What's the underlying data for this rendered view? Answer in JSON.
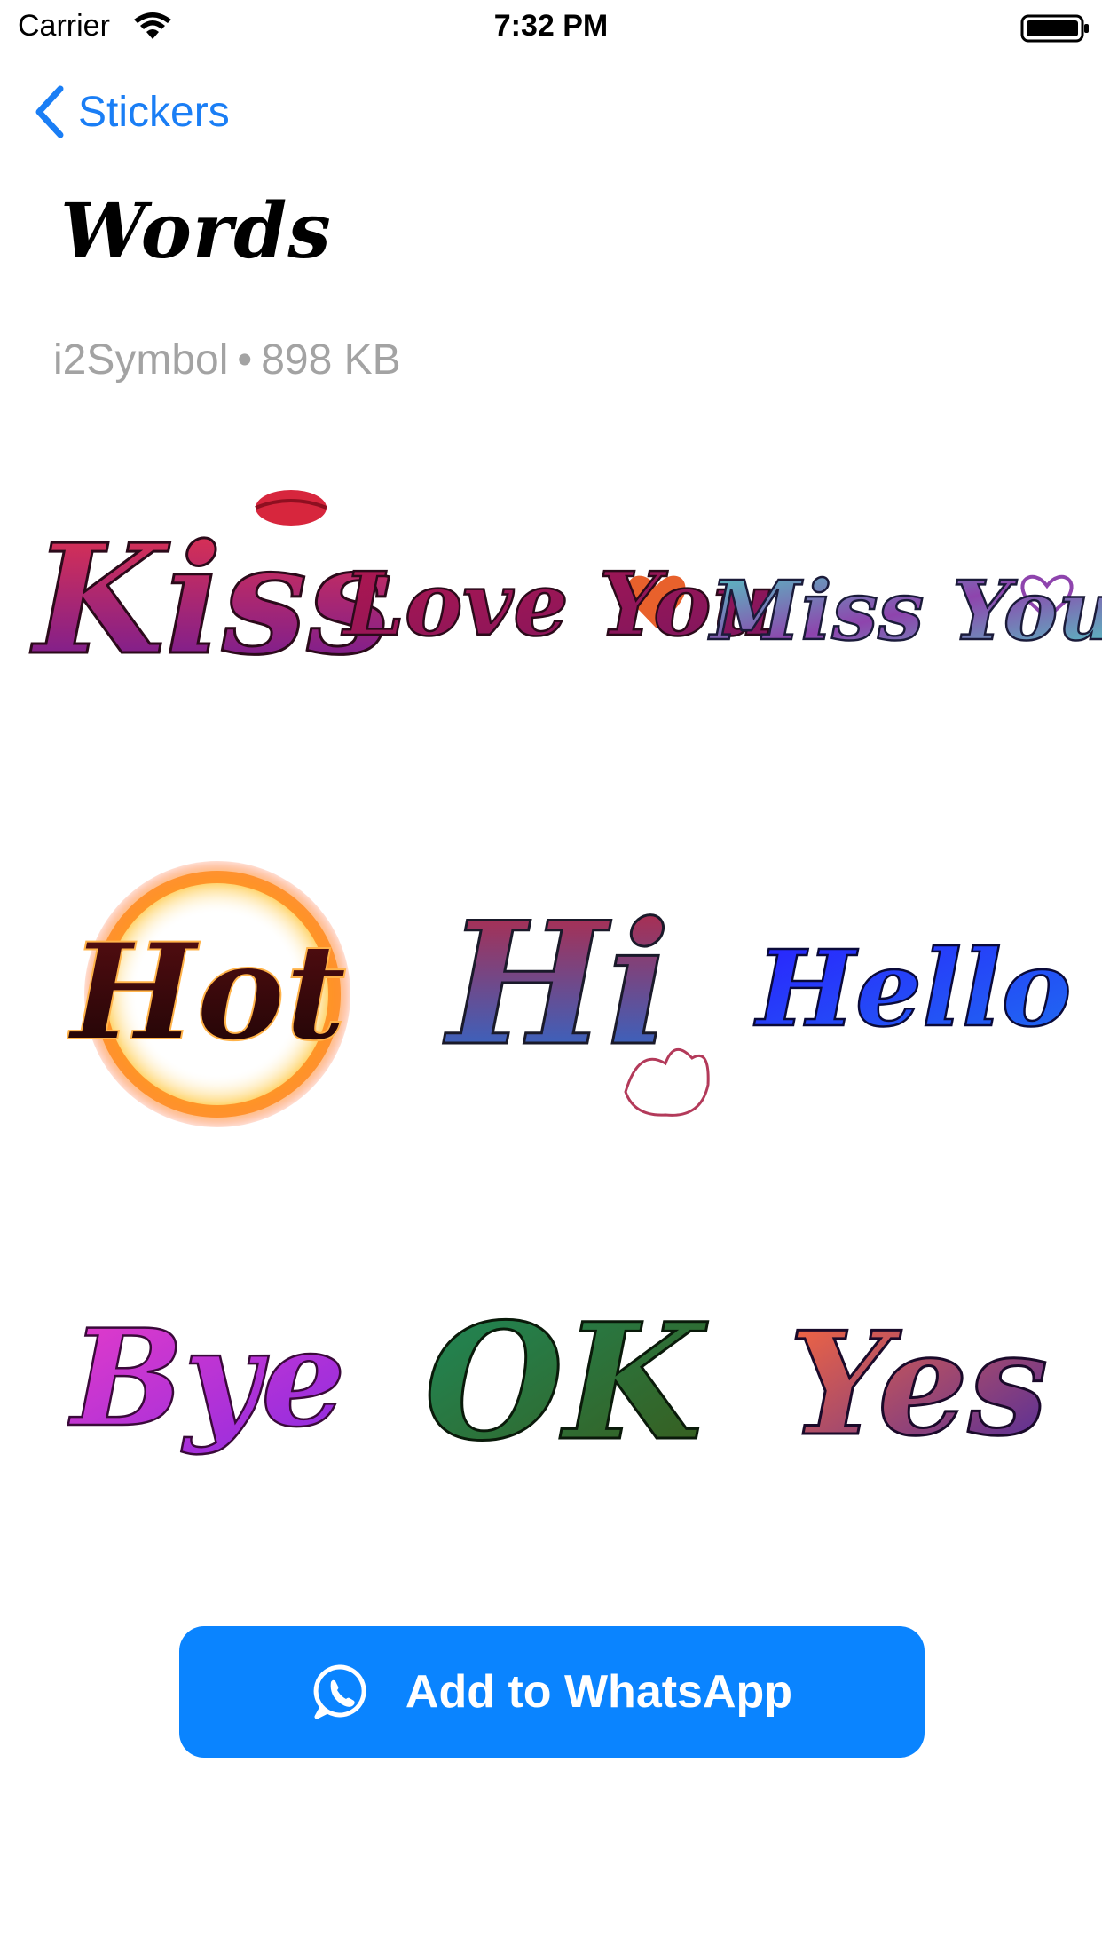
{
  "status_bar": {
    "carrier": "Carrier",
    "time": "7:32 PM"
  },
  "nav": {
    "back_label": "Stickers"
  },
  "pack": {
    "title": "Words",
    "author": "i2Symbol",
    "separator": "•",
    "size": "898 KB"
  },
  "stickers": [
    {
      "word": "Kiss"
    },
    {
      "word": "Love You"
    },
    {
      "word": "Miss You"
    },
    {
      "word": "Hot"
    },
    {
      "word": "Hi"
    },
    {
      "word": "Hello"
    },
    {
      "word": "Bye"
    },
    {
      "word": "OK"
    },
    {
      "word": "Yes"
    }
  ],
  "button": {
    "label": "Add to WhatsApp",
    "icon": "whatsapp-icon"
  },
  "colors": {
    "accent": "#0a84ff",
    "back_link": "#1a7ef5",
    "meta_text": "#a3a3a3"
  }
}
